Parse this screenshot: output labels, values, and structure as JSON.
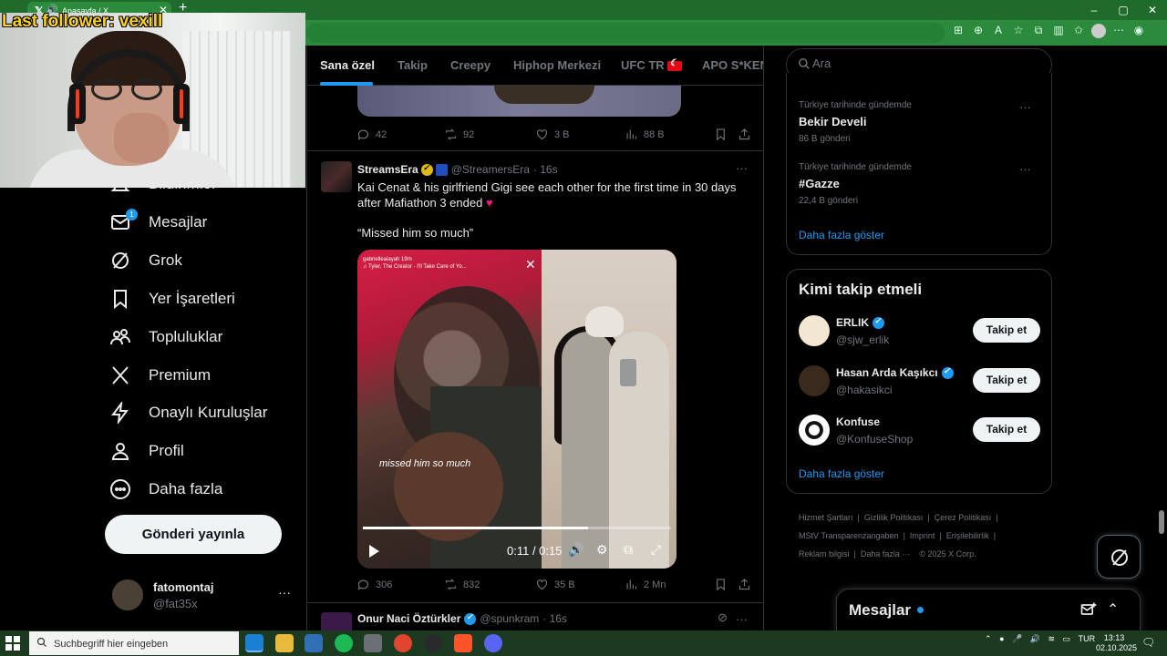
{
  "browser": {
    "tab_title": "Anasayfa / X",
    "new_tab": "+",
    "window_min": "–",
    "window_max": "▢",
    "window_close": "✕",
    "tab_close": "✕"
  },
  "overlay": {
    "last_follower": "Last follower: vexill"
  },
  "nav": {
    "items": [
      {
        "label": "Bildirimler",
        "icon": "bell-icon"
      },
      {
        "label": "Mesajlar",
        "icon": "envelope-icon",
        "badge": "1"
      },
      {
        "label": "Grok",
        "icon": "grok-icon"
      },
      {
        "label": "Yer İşaretleri",
        "icon": "bookmark-icon"
      },
      {
        "label": "Topluluklar",
        "icon": "communities-icon"
      },
      {
        "label": "Premium",
        "icon": "x-logo-icon"
      },
      {
        "label": "Onaylı Kuruluşlar",
        "icon": "lightning-icon"
      },
      {
        "label": "Profil",
        "icon": "person-icon"
      },
      {
        "label": "Daha fazla",
        "icon": "more-circle-icon"
      }
    ],
    "post_button": "Gönderi yayınla",
    "account": {
      "name": "fatomontaj",
      "handle": "@fat35x",
      "more": "···"
    }
  },
  "feed": {
    "tabs": [
      "Sana özel",
      "Takip",
      "Creepy",
      "Hiphop Merkezi",
      "UFC TR",
      "APO S*KEN"
    ],
    "active_tab": "Sana özel",
    "prev_post_actions": {
      "replies": "42",
      "reposts": "92",
      "likes": "3 B",
      "views": "88 B"
    },
    "tweet": {
      "name": "StreamsEra",
      "handle": "@StreamersEra",
      "time": "· 16s",
      "text_line1": "Kai Cenat & his girlfriend Gigi see each other for the first time in 30 days",
      "text_line2": "after Mafiathon 3 ended",
      "heart": "♥",
      "quote": "“Missed him so much”",
      "more": "···",
      "video": {
        "story_user": "gabrielleaiayah  19m",
        "story_song": "♫ Tyler, The Creator · I'll Take Care of Yo...",
        "caption": "missed him so much",
        "time": "0:11 / 0:15",
        "progress": 0.73
      },
      "actions": {
        "replies": "306",
        "reposts": "832",
        "likes": "35 B",
        "views": "2 Mn"
      }
    },
    "next_tweet": {
      "name": "Onur Naci Öztürkler",
      "handle": "@spunkram",
      "time": "· 16s",
      "more": "···"
    }
  },
  "sidebar": {
    "search_placeholder": "Ara",
    "trends": [
      {
        "context": "Türkiye tarihinde gündemde",
        "name": "Bekir Develi",
        "count": "86 B gönderi"
      },
      {
        "context": "Türkiye tarihinde gündemde",
        "name": "#Gazze",
        "count": "22,4 B gönderi"
      }
    ],
    "trends_show_more": "Daha fazla göster",
    "who_to_follow_title": "Kimi takip etmeli",
    "who_to_follow": [
      {
        "name": "ERLIK",
        "handle": "@sjw_erlik",
        "verified": true,
        "button": "Takip et"
      },
      {
        "name": "Hasan Arda Kaşıkcı",
        "handle": "@hakasikci",
        "verified": true,
        "button": "Takip et"
      },
      {
        "name": "Konfuse",
        "handle": "@KonfuseShop",
        "verified": false,
        "button": "Takip et"
      }
    ],
    "wtf_show_more": "Daha fazla göster",
    "footer": [
      "Hizmet Şartları",
      "Gizlilik Politikası",
      "Çerez Politikası",
      "MStV Transparenzangaben",
      "Imprint",
      "Erişilebilirlik",
      "Reklam bilgisi",
      "Daha fazla ···",
      "© 2025 X Corp."
    ],
    "messages_dock": "Mesajlar"
  },
  "taskbar": {
    "search_placeholder": "Suchbegriff hier eingeben",
    "lang": "TUR",
    "time": "13:13",
    "date": "02.10.2025"
  }
}
